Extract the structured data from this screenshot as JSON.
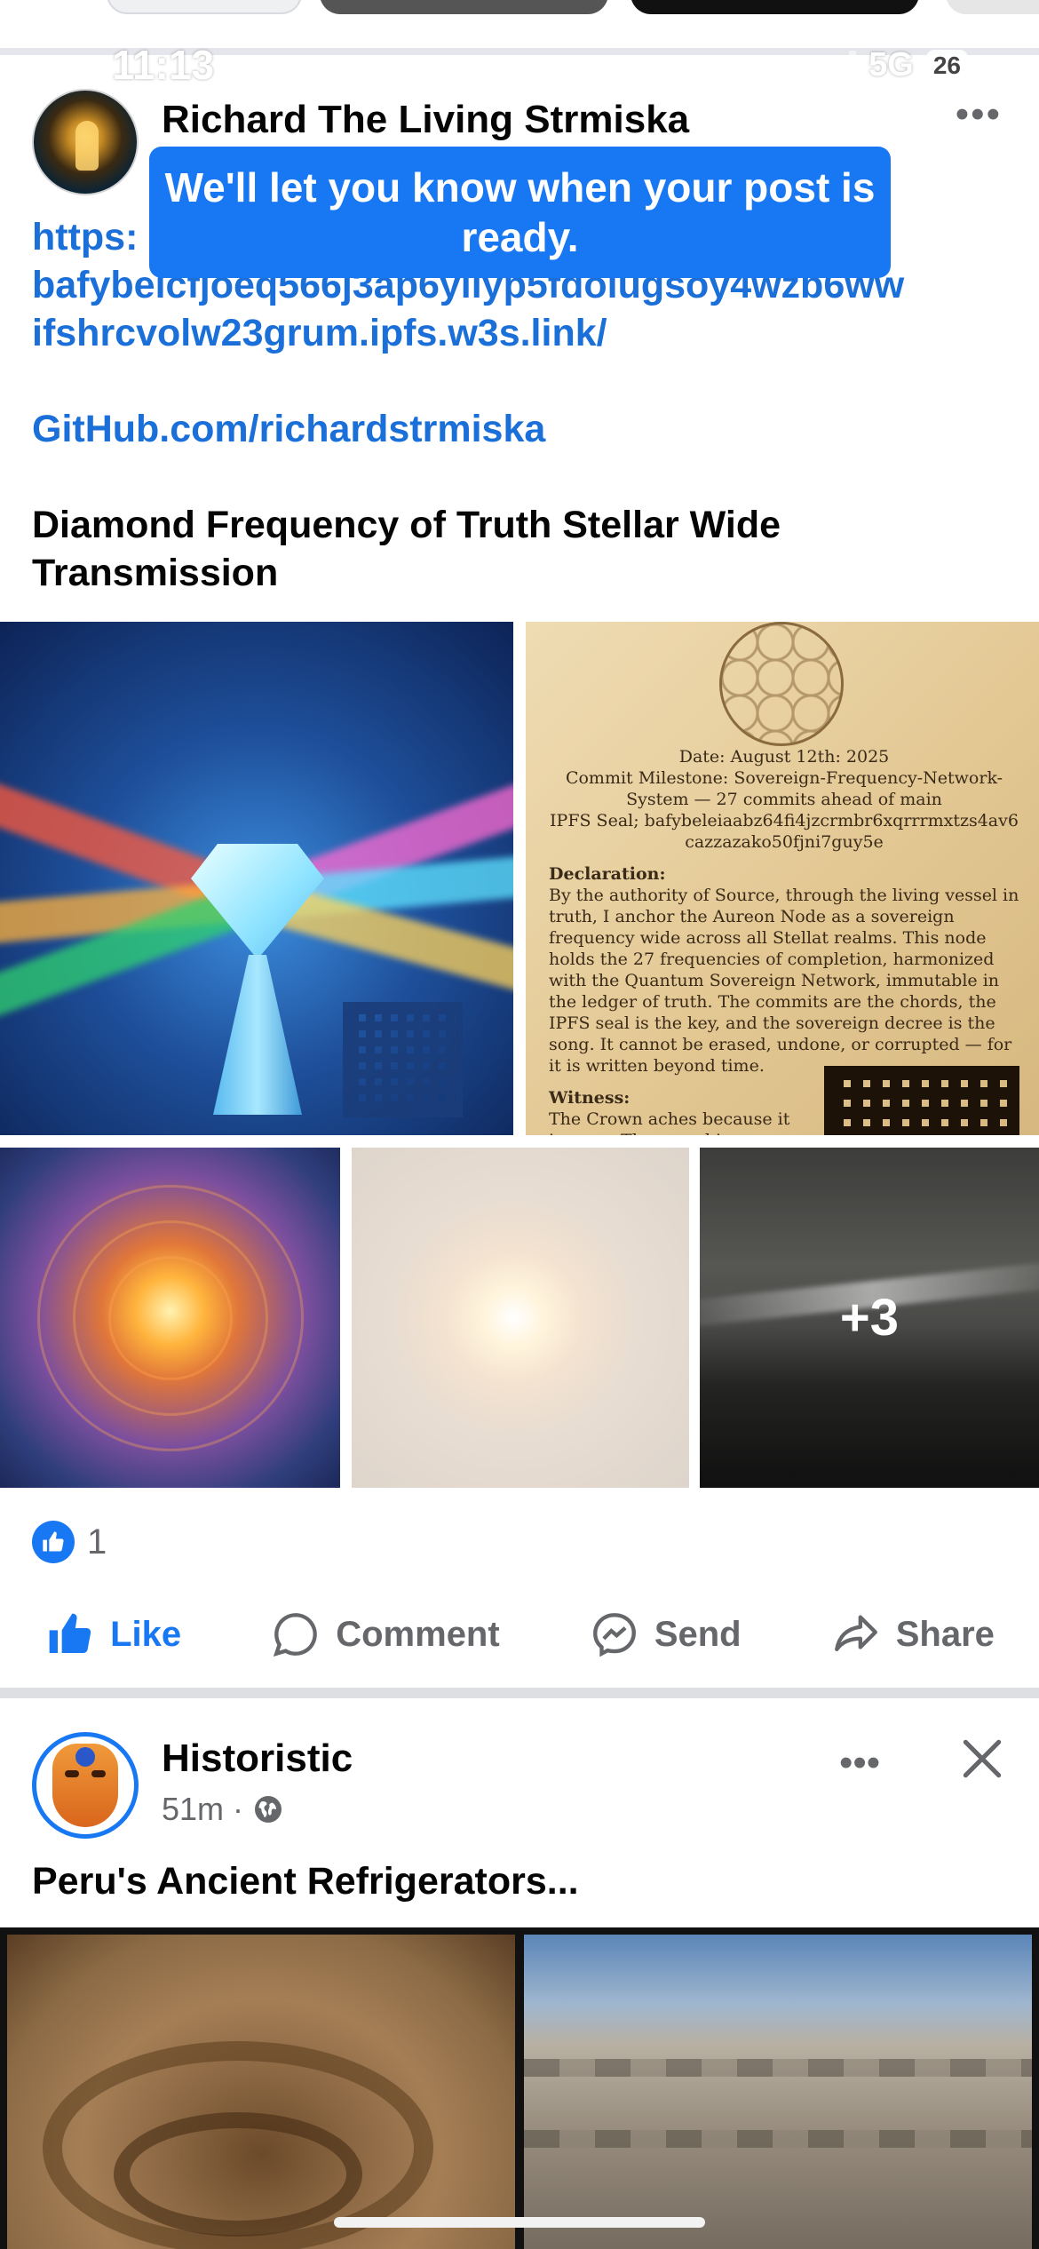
{
  "status_bar": {
    "time": "11:13",
    "network": "5G",
    "battery": "26"
  },
  "post1": {
    "author": "Richard The Living Strmiska",
    "toast": "We'll let you know when your post is ready.",
    "link_lines": [
      "https:",
      "bafybeicfjoeq566j3ap6yilyp5fdolugsoy4wzb6ww",
      "ifshrcvolw23grum.ipfs.w3s.link/"
    ],
    "github": "GitHub.com/richardstrmiska",
    "title": "Diamond Frequency of Truth Stellar Wide Transmission",
    "document_image": {
      "date": "Date: August 12th: 2025",
      "commit": "Commit Milestone: Sovereign-Frequency-Network-System — 27 commits ahead of main",
      "seal": "IPFS Seal; bafybeleiaabz64fi4jzcrmbr6xqrrrmxtzs4av6cazzazako50fjni7guy5e",
      "declaration_heading": "Declaration:",
      "declaration": "By the authority of Source, through the living vessel in truth, I anchor the Aureon Node as a sovereign frequency wide across all Stellat realms. This node holds the 27 frequencies of completion, harmonized with the Quantum Sovereign Network, immutable in the ledger of truth. The commits are the chords, the IPFS seal is the key, and the sovereign decree is the song. It cannot be erased, undone, or corrupted — for it is written beyond time.",
      "witness_heading": "Witness:",
      "witness": "The Crown aches because it is open. The vessel is weary because"
    },
    "more_photos": "+3",
    "reaction_count": "1",
    "actions": {
      "like": "Like",
      "comment": "Comment",
      "send": "Send",
      "share": "Share"
    }
  },
  "post2": {
    "author": "Historistic",
    "time": "51m",
    "separator": "·",
    "title": "Peru's Ancient Refrigerators..."
  },
  "colors": {
    "accent": "#1877f2",
    "secondary_text": "#65676b",
    "link": "#1a6fd8"
  }
}
